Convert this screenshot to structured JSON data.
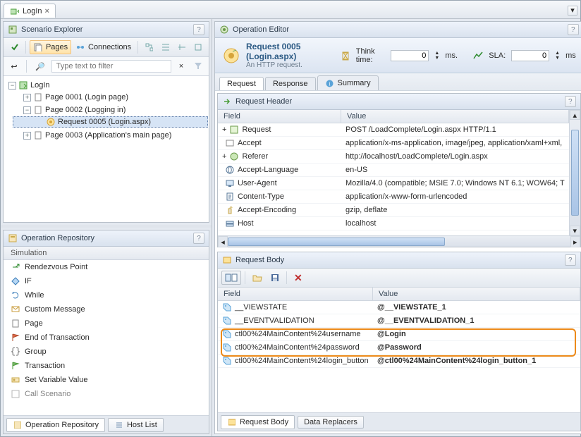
{
  "main_tab": {
    "label": "LogIn"
  },
  "scenario_explorer": {
    "title": "Scenario Explorer",
    "pages_btn": "Pages",
    "connections_btn": "Connections",
    "filter_placeholder": "Type text to filter",
    "tree": {
      "root": "LogIn",
      "n1": "Page 0001 (Login page)",
      "n2": "Page 0002 (Logging in)",
      "n2a": "Request 0005 (Login.aspx)",
      "n3": "Page 0003 (Application's main page)"
    }
  },
  "operation_repository": {
    "title": "Operation Repository",
    "group": "Simulation",
    "items": {
      "rendezvous": "Rendezvous Point",
      "if": "IF",
      "while": "While",
      "custom": "Custom Message",
      "page": "Page",
      "eot": "End of Transaction",
      "group_op": "Group",
      "txn": "Transaction",
      "setvar": "Set Variable Value",
      "call": "Call Scenario"
    },
    "tabs": {
      "op_repo": "Operation Repository",
      "host_list": "Host List"
    }
  },
  "operation_editor": {
    "title": "Operation Editor",
    "op_title": "Request 0005 (Login.aspx)",
    "op_sub": "An HTTP request.",
    "think_label": "Think time:",
    "think_value": "0",
    "ms": "ms.",
    "sla_label": "SLA:",
    "sla_value": "0",
    "ms2": "ms",
    "tabs": {
      "req": "Request",
      "resp": "Response",
      "summary": "Summary"
    }
  },
  "request_header": {
    "title": "Request Header",
    "field_h": "Field",
    "value_h": "Value",
    "rows": {
      "0": {
        "f": "Request",
        "v": "POST /LoadComplete/Login.aspx HTTP/1.1"
      },
      "1": {
        "f": "Accept",
        "v": "application/x-ms-application, image/jpeg, application/xaml+xml,"
      },
      "2": {
        "f": "Referer",
        "v": "http://localhost/LoadComplete/Login.aspx"
      },
      "3": {
        "f": "Accept-Language",
        "v": "en-US"
      },
      "4": {
        "f": "User-Agent",
        "v": "Mozilla/4.0 (compatible; MSIE 7.0; Windows NT 6.1; WOW64; T"
      },
      "5": {
        "f": "Content-Type",
        "v": "application/x-www-form-urlencoded"
      },
      "6": {
        "f": "Accept-Encoding",
        "v": "gzip, deflate"
      },
      "7": {
        "f": "Host",
        "v": "localhost"
      }
    }
  },
  "request_body": {
    "title": "Request Body",
    "field_h": "Field",
    "value_h": "Value",
    "rows": {
      "0": {
        "f": "__VIEWSTATE",
        "v": "@__VIEWSTATE_1"
      },
      "1": {
        "f": "__EVENTVALIDATION",
        "v": "@__EVENTVALIDATION_1"
      },
      "2": {
        "f": "ctl00%24MainContent%24username",
        "v": "@Login"
      },
      "3": {
        "f": "ctl00%24MainContent%24password",
        "v": "@Password"
      },
      "4": {
        "f": "ctl00%24MainContent%24login_button",
        "v": "@ctl00%24MainContent%24login_button_1"
      }
    },
    "tabs": {
      "body": "Request Body",
      "replacers": "Data Replacers"
    }
  }
}
